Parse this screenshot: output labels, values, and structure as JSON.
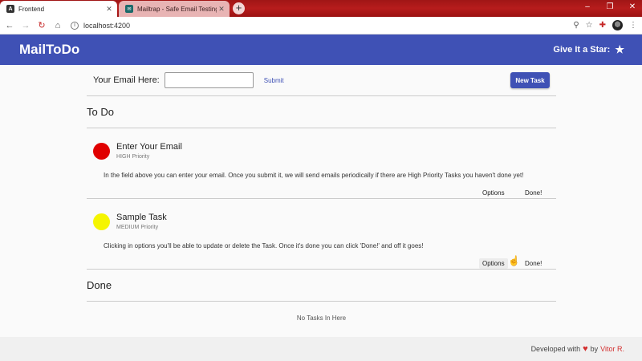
{
  "browser": {
    "tabs": [
      {
        "title": "Frontend",
        "active": true,
        "favicon": "angular-icon"
      },
      {
        "title": "Mailtrap - Safe Email Testing",
        "active": false,
        "favicon": "mailtrap-icon"
      }
    ],
    "url": "localhost:4200"
  },
  "header": {
    "brand": "MailToDo",
    "star_label": "Give It a Star:"
  },
  "email_form": {
    "label": "Your Email Here:",
    "value": "",
    "placeholder": "",
    "submit_label": "Submit",
    "new_task_label": "New Task"
  },
  "todo": {
    "title": "To Do",
    "tasks": [
      {
        "title": "Enter Your Email",
        "priority": "HIGH Priority",
        "color": "#e00000",
        "description": "In the field above you can enter your email. Once you submit it, we will send emails periodically if there are High Priority Tasks you haven't done yet!",
        "options_label": "Options",
        "done_label": "Done!"
      },
      {
        "title": "Sample Task",
        "priority": "MEDIUM Priority",
        "color": "#f5f500",
        "description": "Clicking in options you'll be able to update or delete the Task. Once it's done you can click 'Done!' and off it goes!",
        "options_label": "Options",
        "done_label": "Done!"
      }
    ]
  },
  "done": {
    "title": "Done",
    "empty_text": "No Tasks In Here"
  },
  "footer": {
    "prefix": "Developed with",
    "suffix": "by",
    "author": "Vitor R."
  },
  "colors": {
    "primary": "#3f51b5",
    "tabstrip": "#b71c1c",
    "heart": "#d32f2f"
  }
}
